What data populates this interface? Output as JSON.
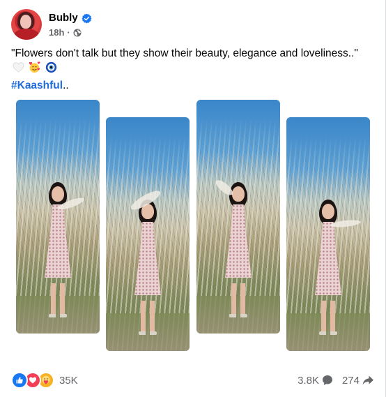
{
  "post": {
    "author": "Bubly",
    "time": "18h",
    "separator": "·",
    "caption_text": "\"Flowers don't talk but they show their beauty, elegance and loveliness..\"",
    "hashtag": "#Kaashful",
    "hashtag_suffix": "..",
    "emojis": [
      "white-heart-icon",
      "smiling-face-with-hearts-icon",
      "nazar-amulet-icon"
    ]
  },
  "photos": [
    {
      "name": "photo-1",
      "alt_icon": "photo"
    },
    {
      "name": "photo-2",
      "alt_icon": "photo"
    },
    {
      "name": "photo-3",
      "alt_icon": "photo"
    },
    {
      "name": "photo-4",
      "alt_icon": "photo"
    }
  ],
  "footer": {
    "reaction_icons": [
      "like-icon",
      "love-icon",
      "care-icon"
    ],
    "reaction_count": "35K",
    "comment_count": "3.8K",
    "share_count": "274"
  },
  "colors": {
    "link": "#216fdb",
    "verified": "#1877f2",
    "secondary_text": "#65676b",
    "like": "#1877f2",
    "love": "#f33e58",
    "care": "#f7b125"
  }
}
